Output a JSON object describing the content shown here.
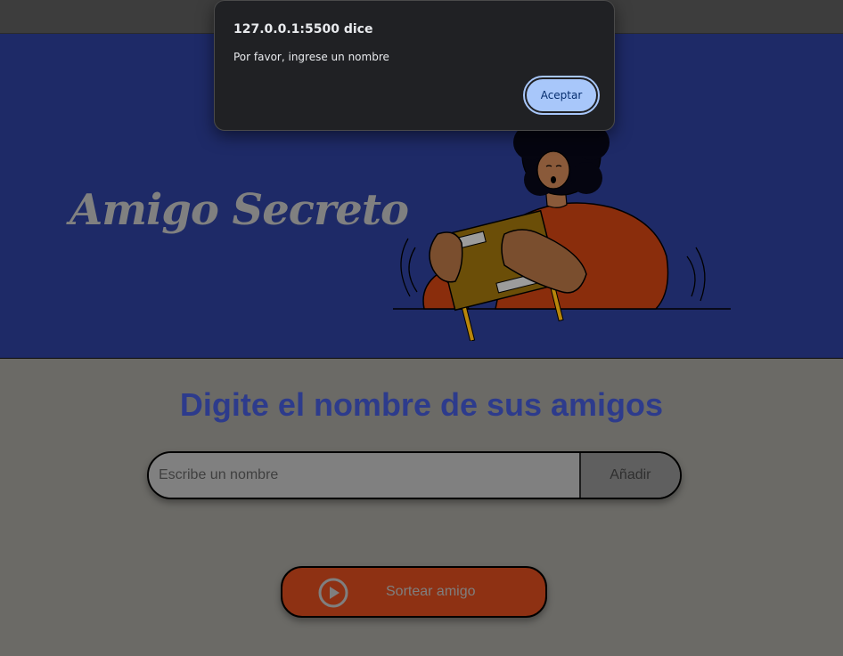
{
  "dialog": {
    "title": "127.0.0.1:5500 dice",
    "message": "Por favor, ingrese un nombre",
    "ok_label": "Aceptar"
  },
  "header": {
    "title": "Amigo Secreto"
  },
  "main": {
    "section_title": "Digite el nombre de sus amigos",
    "name_input": {
      "placeholder": "Escribe un nombre",
      "value": ""
    },
    "add_button_label": "Añadir",
    "draw_button_label": "Sortear amigo"
  },
  "colors": {
    "header_bg": "#1e2a67",
    "main_bg": "#6b6a66",
    "section_title": "#2d3b8c",
    "draw_button_bg": "#8e3113",
    "dialog_bg": "#202124",
    "dialog_button": "#a8c7fa"
  },
  "icons": {
    "draw_button_icon": "play-circle-icon",
    "illustration": "person-with-gift-box"
  }
}
